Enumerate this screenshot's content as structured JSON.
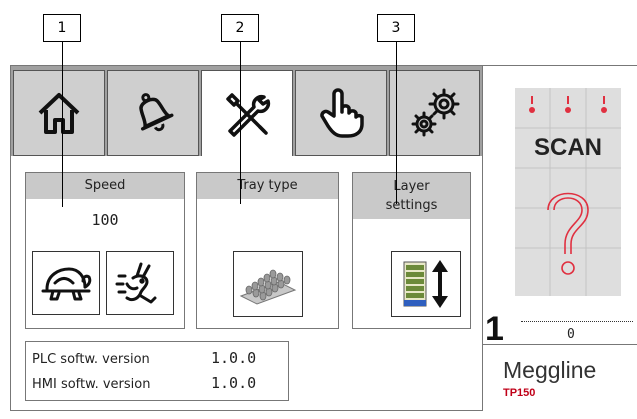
{
  "callouts": [
    "1",
    "2",
    "3"
  ],
  "tabs": [
    {
      "icon": "home-icon",
      "active": false
    },
    {
      "icon": "bell-icon",
      "active": false
    },
    {
      "icon": "tools-icon",
      "active": true
    },
    {
      "icon": "hand-pointer-icon",
      "active": false
    },
    {
      "icon": "gears-icon",
      "active": false
    }
  ],
  "speed": {
    "title": "Speed",
    "value": "100",
    "buttons": [
      "turtle-icon",
      "rabbit-icon"
    ]
  },
  "tray_type": {
    "title": "Tray type",
    "button": "egg-tray-icon"
  },
  "layer_settings": {
    "title_line1": "Layer",
    "title_line2": "settings",
    "button": "layer-stack-arrows-icon"
  },
  "versions": {
    "plc_label": "PLC softw. version",
    "plc_value": "1.0.0",
    "hmi_label": "HMI softw. version",
    "hmi_value": "1.0.0"
  },
  "side": {
    "scan_label": "SCAN",
    "count": "1",
    "count_value": "0",
    "brand": "Meggline",
    "model": "TP150"
  },
  "colors": {
    "tabbar": "#a0a0a0",
    "tab": "#cfcfcf",
    "panel_header": "#c9c9c9",
    "brand_red": "#c00018",
    "scan_bg": "#dedede",
    "question_red": "#e03040"
  }
}
